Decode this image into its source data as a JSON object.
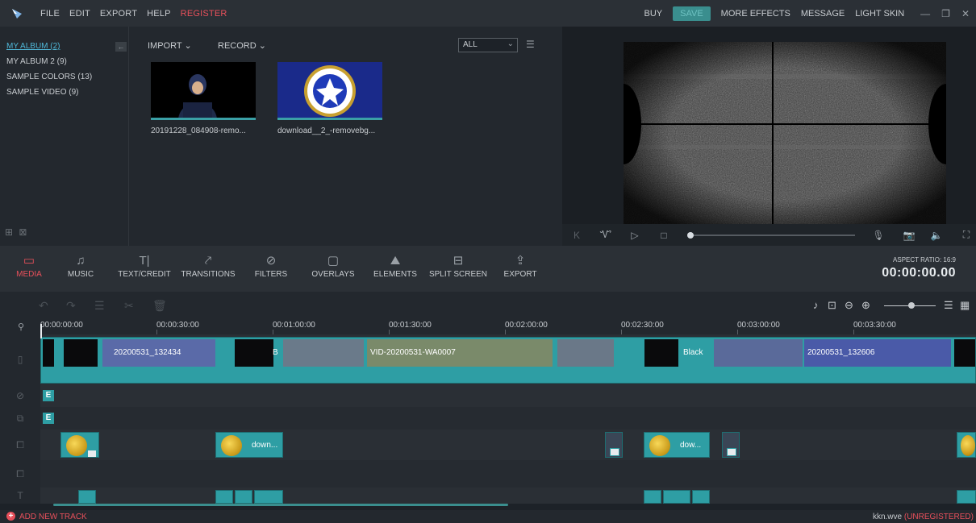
{
  "menu": [
    "FILE",
    "EDIT",
    "EXPORT",
    "HELP"
  ],
  "register_label": "REGISTER",
  "top_actions": {
    "buy": "BUY",
    "save": "SAVE",
    "more_effects": "MORE EFFECTS",
    "message": "MESSAGE",
    "light_skin": "LIGHT SKIN"
  },
  "albums": [
    {
      "label": "MY ALBUM (2)",
      "active": true
    },
    {
      "label": "MY ALBUM 2 (9)",
      "active": false
    },
    {
      "label": "SAMPLE COLORS (13)",
      "active": false
    },
    {
      "label": "SAMPLE VIDEO (9)",
      "active": false
    }
  ],
  "library": {
    "import": "IMPORT",
    "record": "RECORD",
    "filter": "ALL"
  },
  "media": [
    {
      "name": "20191228_084908-remo..."
    },
    {
      "name": "download__2_-removebg..."
    }
  ],
  "tools": [
    {
      "label": "MEDIA",
      "icon": "folder-icon",
      "active": true
    },
    {
      "label": "MUSIC",
      "icon": "music-icon",
      "active": false
    },
    {
      "label": "TEXT/CREDIT",
      "icon": "text-icon",
      "active": false
    },
    {
      "label": "TRANSITIONS",
      "icon": "transitions-icon",
      "active": false
    },
    {
      "label": "FILTERS",
      "icon": "filters-icon",
      "active": false
    },
    {
      "label": "OVERLAYS",
      "icon": "overlays-icon",
      "active": false
    },
    {
      "label": "ELEMENTS",
      "icon": "elements-icon",
      "active": false
    },
    {
      "label": "SPLIT SCREEN",
      "icon": "split-screen-icon",
      "active": false
    },
    {
      "label": "EXPORT",
      "icon": "export-icon",
      "active": false
    }
  ],
  "aspect_ratio": "ASPECT RATIO: 16:9",
  "timecode": "00:00:00.00",
  "ruler": [
    "00:00:00:00",
    "00:00:30:00",
    "00:01:00:00",
    "00:01:30:00",
    "00:02:00:00",
    "00:02:30:00",
    "00:03:00:00",
    "00:03:30:00"
  ],
  "clips": {
    "v1": "20200531_132434",
    "v2": "B",
    "v3": "VID-20200531-WA0007",
    "v4": "Black",
    "v5": "20200531_132606",
    "pip1": "down...",
    "pip2": "dow...",
    "e1": "E",
    "e2": "E"
  },
  "add_track": "ADD NEW TRACK",
  "project": {
    "file": "kkn.wve",
    "status": "(UNREGISTERED)"
  },
  "colors": {
    "accent": "#e8505b",
    "clip": "#2e9ea4",
    "link": "#4fb6d6"
  }
}
